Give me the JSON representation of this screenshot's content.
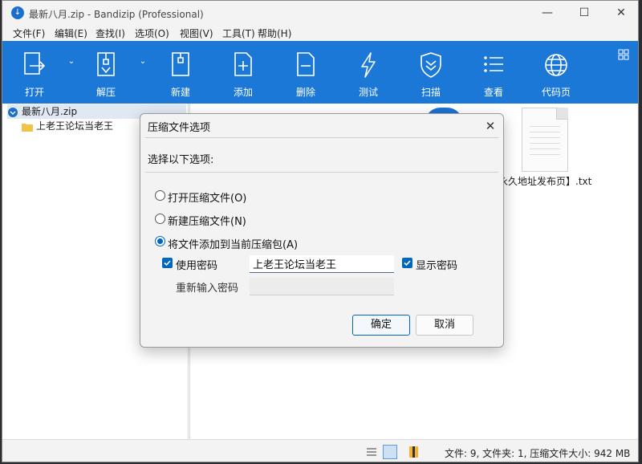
{
  "window": {
    "title": "最新八月.zip - Bandizip (Professional)"
  },
  "menu": [
    "文件(F)",
    "编辑(E)",
    "查找(I)",
    "选项(O)",
    "视图(V)",
    "工具(T)",
    "帮助(H)"
  ],
  "toolbar": {
    "open": "打开",
    "extract": "解压",
    "new": "新建",
    "add": "添加",
    "delete": "删除",
    "test": "测试",
    "scan": "扫描",
    "view": "查看",
    "codepage": "代码页"
  },
  "tree": {
    "root": "最新八月.zip",
    "folder": "上老王论坛当老王"
  },
  "file_area": {
    "file_name": "永久地址发布页】.txt"
  },
  "status": {
    "text": "文件: 9, 文件夹: 1, 压缩文件大小: 942 MB"
  },
  "dialog": {
    "title": "压缩文件选项",
    "prompt": "选择以下选项:",
    "option_open": "打开压缩文件(O)",
    "option_new": "新建压缩文件(N)",
    "option_add": "将文件添加到当前压缩包(A)",
    "use_password": "使用密码",
    "password_value": "上老王论坛当老王",
    "show_password": "显示密码",
    "reenter_password": "重新输入密码",
    "ok": "确定",
    "cancel": "取消"
  },
  "colors": {
    "toolbar": "#1b78d6",
    "accent": "#0067c0"
  }
}
